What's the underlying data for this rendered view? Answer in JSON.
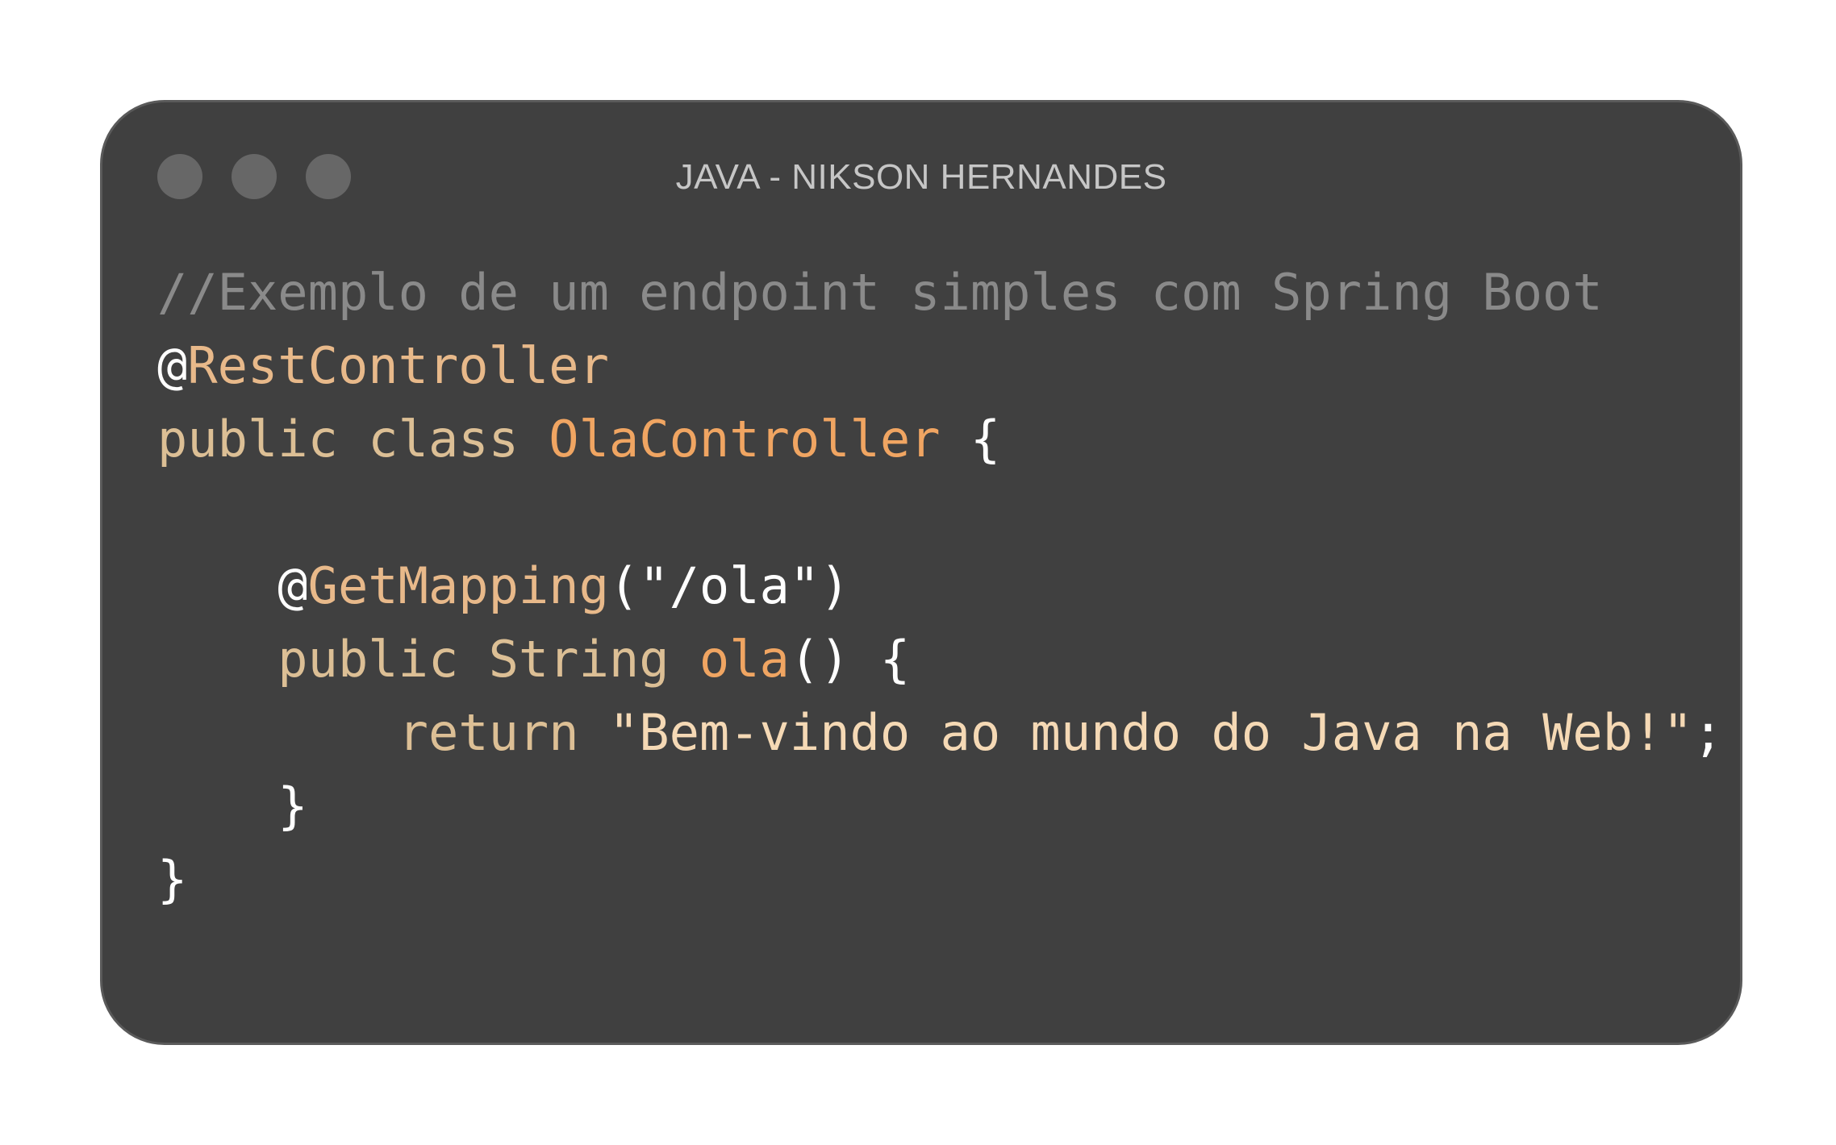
{
  "window": {
    "title": "JAVA - NIKSON HERNANDES",
    "controls": [
      "close",
      "minimize",
      "maximize"
    ]
  },
  "colors": {
    "background": "#ffffff",
    "window": "#404040",
    "dots": "#676767",
    "comment": "#8a8a8a",
    "keyword": "#dcbf95",
    "type": "#f0a562",
    "string": "#f5d9b5",
    "punctuation": "#ffffff"
  },
  "code": {
    "lines": [
      [
        {
          "t": "//Exemplo de um endpoint simples com Spring Boot",
          "k": "comment"
        }
      ],
      [
        {
          "t": "@",
          "k": "punct"
        },
        {
          "t": "RestController",
          "k": "annot"
        }
      ],
      [
        {
          "t": "public class ",
          "k": "keyword"
        },
        {
          "t": "OlaController",
          "k": "type"
        },
        {
          "t": " {",
          "k": "punct"
        }
      ],
      [],
      [
        {
          "t": "    @",
          "k": "punct"
        },
        {
          "t": "GetMapping",
          "k": "annot"
        },
        {
          "t": "(\"/ola\")",
          "k": "punct"
        }
      ],
      [
        {
          "t": "    public String ",
          "k": "keyword"
        },
        {
          "t": "ola",
          "k": "type"
        },
        {
          "t": "() {",
          "k": "punct"
        }
      ],
      [
        {
          "t": "        return ",
          "k": "keyword"
        },
        {
          "t": "\"Bem-vindo ao mundo do Java na Web!\"",
          "k": "string"
        },
        {
          "t": ";",
          "k": "punct"
        }
      ],
      [
        {
          "t": "    }",
          "k": "punct"
        }
      ],
      [
        {
          "t": "}",
          "k": "punct"
        }
      ]
    ]
  }
}
